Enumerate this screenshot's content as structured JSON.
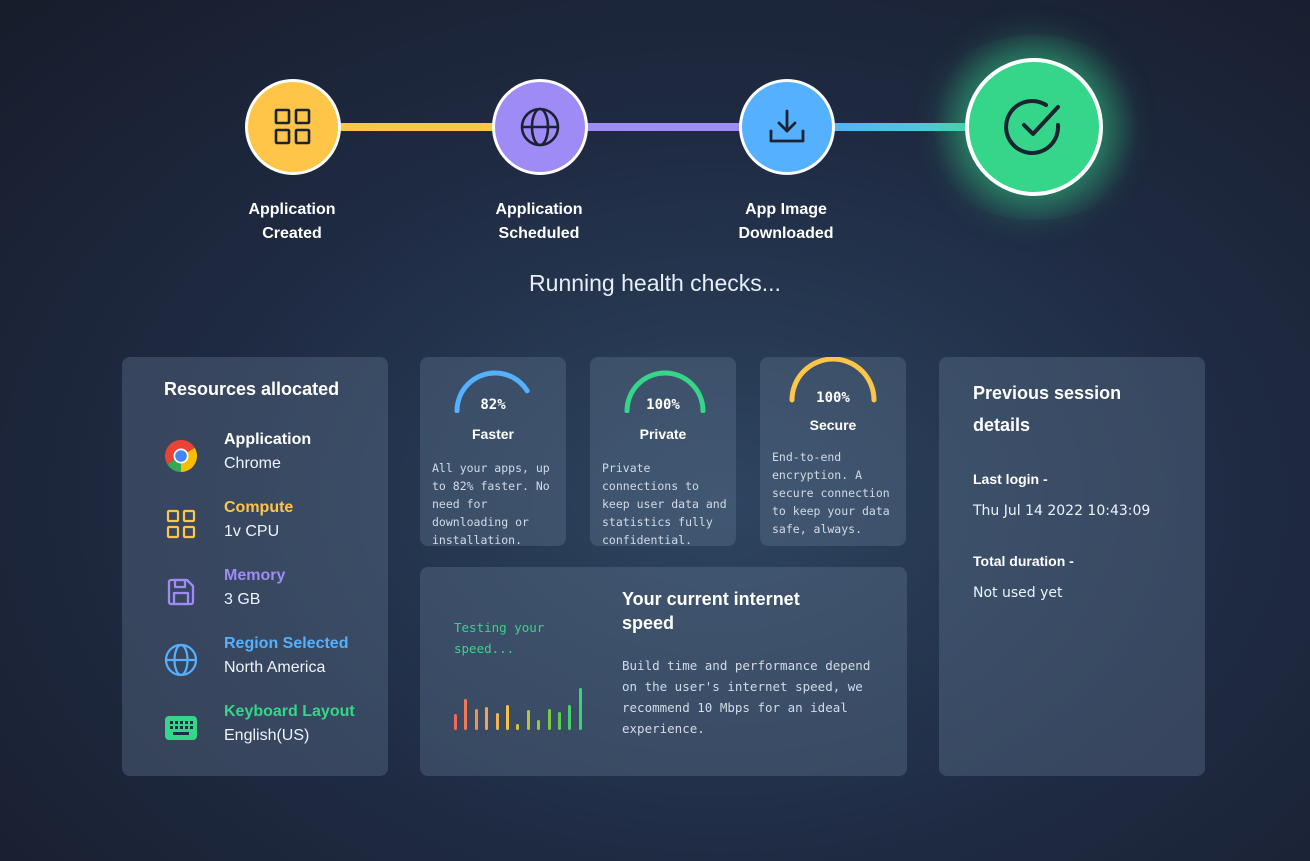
{
  "steps": [
    {
      "label_line1": "Application",
      "label_line2": "Created",
      "icon": "grid-icon",
      "color": "#ffc548"
    },
    {
      "label_line1": "Application",
      "label_line2": "Scheduled",
      "icon": "globe-icon",
      "color": "#9f8bf6"
    },
    {
      "label_line1": "App Image",
      "label_line2": "Downloaded",
      "icon": "download-icon",
      "color": "#55b1ff"
    },
    {
      "icon": "check-circle-icon",
      "color": "#35d689",
      "active": true
    }
  ],
  "status": "Running health checks...",
  "resources": {
    "title": "Resources allocated",
    "items": [
      {
        "label": "Application",
        "value": "Chrome",
        "icon": "chrome-icon",
        "color": "#ffffff"
      },
      {
        "label": "Compute",
        "value": "1v CPU",
        "icon": "grid-icon",
        "color": "#ffc548"
      },
      {
        "label": "Memory",
        "value": "3 GB",
        "icon": "floppy-disk-icon",
        "color": "#9f8bf6"
      },
      {
        "label": "Region Selected",
        "value": "North America",
        "icon": "globe-icon",
        "color": "#55b1ff"
      },
      {
        "label": "Keyboard Layout",
        "value": "English(US)",
        "icon": "keyboard-icon",
        "color": "#35d689"
      }
    ]
  },
  "features": [
    {
      "percent": "82%",
      "fraction": 0.82,
      "title": "Faster",
      "color": "#55b1ff",
      "description": "All your apps, up to 82% faster. No need for downloading or installation."
    },
    {
      "percent": "100%",
      "fraction": 1.0,
      "title": "Private",
      "color": "#35d689",
      "description": "Private connections to keep user data and statistics fully confidential."
    },
    {
      "percent": "100%",
      "fraction": 1.0,
      "title": "Secure",
      "color": "#ffc548",
      "description": "End-to-end encryption. A secure connection to keep your data safe, always."
    }
  ],
  "speed": {
    "status": "Testing your speed...",
    "title": "Your current internet speed",
    "description": "Build time and performance depend on the user's internet speed, we recommend 10 Mbps for an ideal experience."
  },
  "session": {
    "title": "Previous session details",
    "last_login_label": "Last login -",
    "last_login_value": "Thu Jul 14 2022 10:43:09",
    "duration_label": "Total duration -",
    "duration_value": "Not used yet"
  }
}
